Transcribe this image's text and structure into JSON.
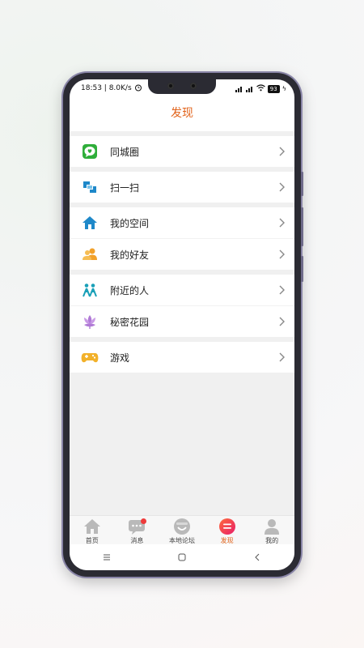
{
  "status": {
    "time_speed": "18:53 | 8.0K/s",
    "battery": "93"
  },
  "header": {
    "title": "发现"
  },
  "groups": [
    {
      "items": [
        {
          "label": "同城圈",
          "icon": "chat-heart-icon",
          "color": "#2fae3a"
        }
      ]
    },
    {
      "items": [
        {
          "label": "扫一扫",
          "icon": "scan-icon",
          "color": "#1e88c9"
        }
      ]
    },
    {
      "items": [
        {
          "label": "我的空间",
          "icon": "home-icon",
          "color": "#1e88c9"
        },
        {
          "label": "我的好友",
          "icon": "friends-icon",
          "color": "#f2a12a"
        }
      ]
    },
    {
      "items": [
        {
          "label": "附近的人",
          "icon": "people-nearby-icon",
          "color": "#1aa0b8"
        },
        {
          "label": "秘密花园",
          "icon": "lotus-icon",
          "color": "#b07ad6"
        }
      ]
    },
    {
      "items": [
        {
          "label": "游戏",
          "icon": "gamepad-icon",
          "color": "#f2b12a"
        }
      ]
    }
  ],
  "tabbar": {
    "tabs": [
      {
        "label": "首页",
        "icon": "house-icon"
      },
      {
        "label": "消息",
        "icon": "message-icon",
        "badge": true
      },
      {
        "label": "本地论坛",
        "icon": "smile-forum-icon"
      },
      {
        "label": "发现",
        "icon": "discover-icon",
        "active": true
      },
      {
        "label": "我的",
        "icon": "profile-icon"
      }
    ]
  },
  "colors": {
    "accent": "#e1631b",
    "badge": "#ee3b3b"
  }
}
